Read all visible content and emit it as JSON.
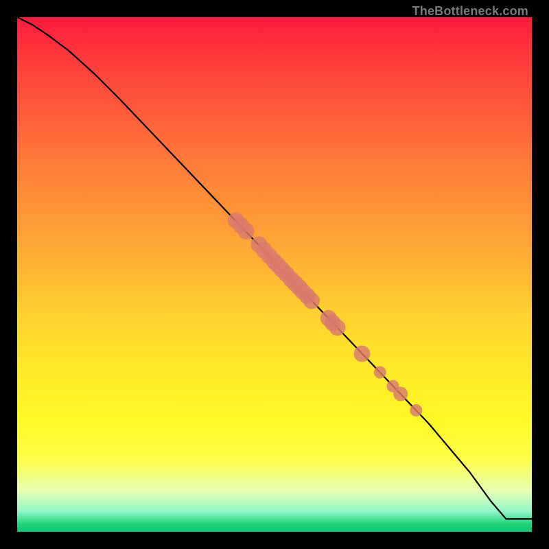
{
  "watermark": "TheBottleneck.com",
  "colors": {
    "background": "#000000",
    "curve_stroke": "#000000",
    "marker_fill": "#d97a6e"
  },
  "chart_data": {
    "type": "line",
    "title": "",
    "xlabel": "",
    "ylabel": "",
    "xlim": [
      0,
      100
    ],
    "ylim": [
      0,
      100
    ],
    "grid": false,
    "legend": false,
    "series": [
      {
        "name": "bottleneck-curve",
        "x": [
          0,
          3,
          6,
          10,
          15,
          20,
          30,
          40,
          50,
          60,
          70,
          80,
          88,
          92,
          95,
          100
        ],
        "y": [
          100,
          98.5,
          96.5,
          93.5,
          89,
          84,
          73.5,
          63,
          52.5,
          42,
          31.5,
          21,
          11.5,
          6,
          2.5,
          2.5
        ]
      }
    ],
    "markers": [
      {
        "x": 42.5,
        "y": 60.5,
        "r": 1.6
      },
      {
        "x": 43.5,
        "y": 59.5,
        "r": 1.6
      },
      {
        "x": 44.5,
        "y": 58.4,
        "r": 1.6
      },
      {
        "x": 47.0,
        "y": 55.8,
        "r": 1.6
      },
      {
        "x": 48.0,
        "y": 54.7,
        "r": 1.6
      },
      {
        "x": 49.0,
        "y": 53.6,
        "r": 1.6
      },
      {
        "x": 50.0,
        "y": 52.5,
        "r": 1.6
      },
      {
        "x": 50.7,
        "y": 51.8,
        "r": 1.6
      },
      {
        "x": 51.5,
        "y": 50.9,
        "r": 1.6
      },
      {
        "x": 52.3,
        "y": 50.1,
        "r": 1.6
      },
      {
        "x": 53.2,
        "y": 49.1,
        "r": 1.6
      },
      {
        "x": 54.0,
        "y": 48.3,
        "r": 1.6
      },
      {
        "x": 54.8,
        "y": 47.5,
        "r": 1.6
      },
      {
        "x": 55.5,
        "y": 46.7,
        "r": 1.6
      },
      {
        "x": 56.4,
        "y": 45.8,
        "r": 1.6
      },
      {
        "x": 57.2,
        "y": 44.9,
        "r": 1.6
      },
      {
        "x": 60.5,
        "y": 41.5,
        "r": 1.6
      },
      {
        "x": 61.3,
        "y": 40.6,
        "r": 1.6
      },
      {
        "x": 62.2,
        "y": 39.7,
        "r": 1.6
      },
      {
        "x": 67.0,
        "y": 34.6,
        "r": 1.6
      },
      {
        "x": 70.5,
        "y": 31.0,
        "r": 1.2
      },
      {
        "x": 73.0,
        "y": 28.3,
        "r": 1.2
      },
      {
        "x": 74.5,
        "y": 26.8,
        "r": 1.4
      },
      {
        "x": 77.5,
        "y": 23.6,
        "r": 1.2
      }
    ]
  }
}
